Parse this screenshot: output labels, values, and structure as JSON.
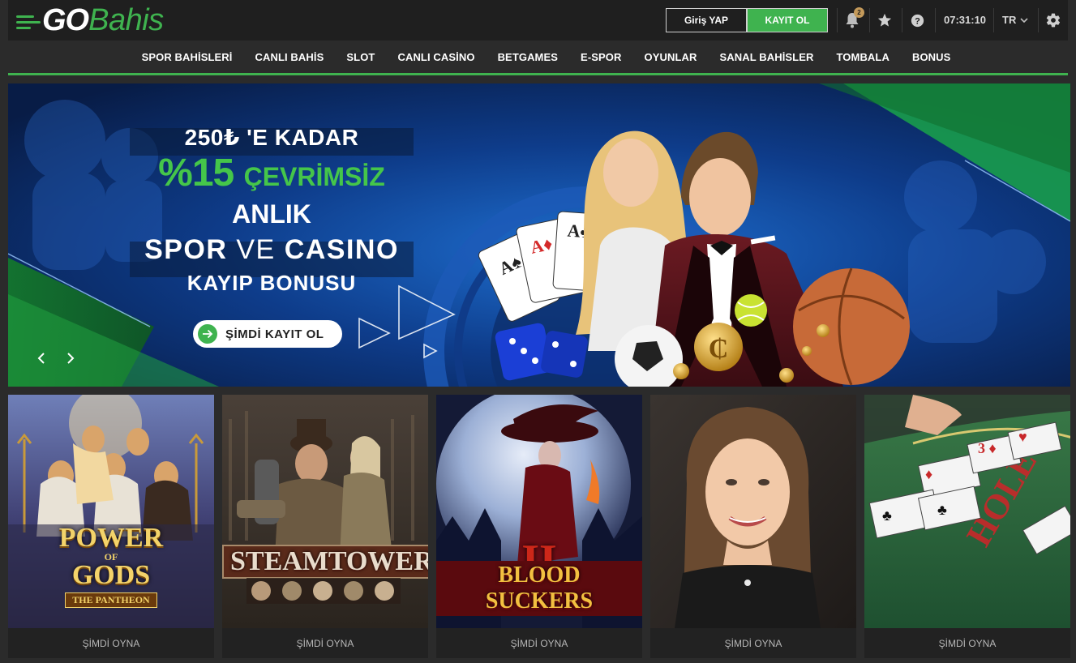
{
  "header": {
    "logo_go": "GO",
    "logo_bahis": "Bahis",
    "login_label": "Giriş YAP",
    "register_label": "KAYIT OL",
    "notification_count": "2",
    "time": "07:31:10",
    "language": "TR"
  },
  "nav": {
    "items": [
      "SPOR BAHİSLERİ",
      "CANLI BAHİS",
      "SLOT",
      "CANLI CASİNO",
      "BETGAMES",
      "E-SPOR",
      "OYUNLAR",
      "SANAL BAHİSLER",
      "TOMBALA",
      "BONUS"
    ]
  },
  "banner": {
    "line1": "250₺ 'E KADAR",
    "line2_big": "%15",
    "line2_small": "ÇEVRİMSİZ",
    "line3": "ANLIK",
    "line4_a": "SPOR",
    "line4_b": "VE",
    "line4_c": "CASINO",
    "line5": "KAYIP BONUSU",
    "cta_label": "ŞİMDİ KAYIT OL"
  },
  "games": {
    "items": [
      {
        "title_a": "POWER",
        "title_b": "OF",
        "title_c": "GODS",
        "title_d": "THE PANTHEON",
        "play_label": "ŞİMDİ OYNA"
      },
      {
        "title_a": "STEAMTOWER",
        "play_label": "ŞİMDİ OYNA"
      },
      {
        "title_a": "BLOOD SUCKERS",
        "title_b": "II",
        "play_label": "ŞİMDİ OYNA"
      },
      {
        "play_label": "ŞİMDİ OYNA"
      },
      {
        "play_label": "ŞİMDİ OYNA"
      }
    ]
  },
  "colors": {
    "accent": "#3fb34f",
    "topbar": "#1f1f1f",
    "nav_bg": "#2b2b2b",
    "badge": "#c49a5a"
  },
  "icons": [
    "bell-icon",
    "star-icon",
    "help-icon",
    "chevron-down-icon",
    "gear-icon",
    "arrow-right-icon",
    "chevron-left-icon",
    "chevron-right-icon"
  ]
}
